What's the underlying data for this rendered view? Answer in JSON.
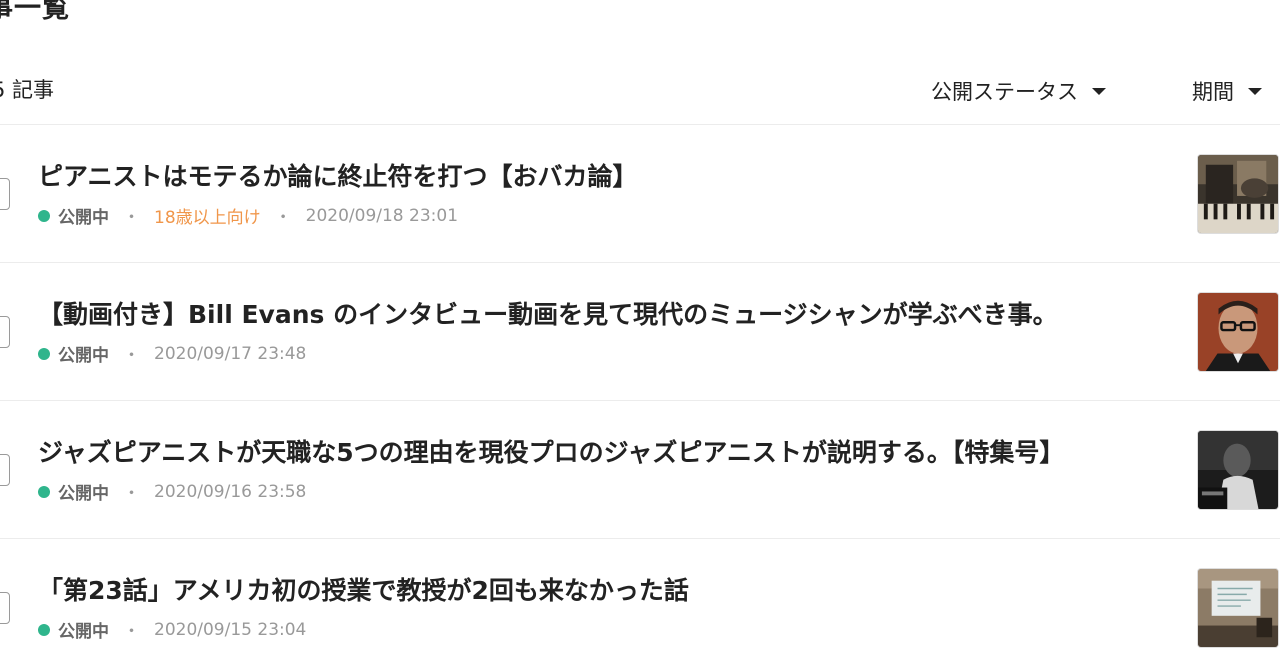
{
  "page": {
    "heading": "事一覧",
    "count_label": "5 記事"
  },
  "filters": {
    "status_label": "公開ステータス",
    "period_label": "期間"
  },
  "articles": [
    {
      "title": "ピアニストはモテるか論に終止符を打つ【おバカ論】",
      "status": "公開中",
      "age_label": "18歳以上向け",
      "date": "2020/09/18 23:01",
      "thumbnail": "piano-photo"
    },
    {
      "title": "【動画付き】Bill Evans のインタビュー動画を見て現代のミュージシャンが学ぶべき事。",
      "status": "公開中",
      "date": "2020/09/17 23:48",
      "thumbnail": "portrait-photo"
    },
    {
      "title": "ジャズピアニストが天職な5つの理由を現役プロのジャズピアニストが説明する。【特集号】",
      "status": "公開中",
      "date": "2020/09/16 23:58",
      "thumbnail": "pianist-bw-photo"
    },
    {
      "title": "「第23話」アメリカ初の授業で教授が2回も来なかった話",
      "status": "公開中",
      "date": "2020/09/15 23:04",
      "thumbnail": "classroom-photo"
    }
  ],
  "colors": {
    "status_dot": "#2fb58c",
    "age_label": "#f0964a"
  }
}
